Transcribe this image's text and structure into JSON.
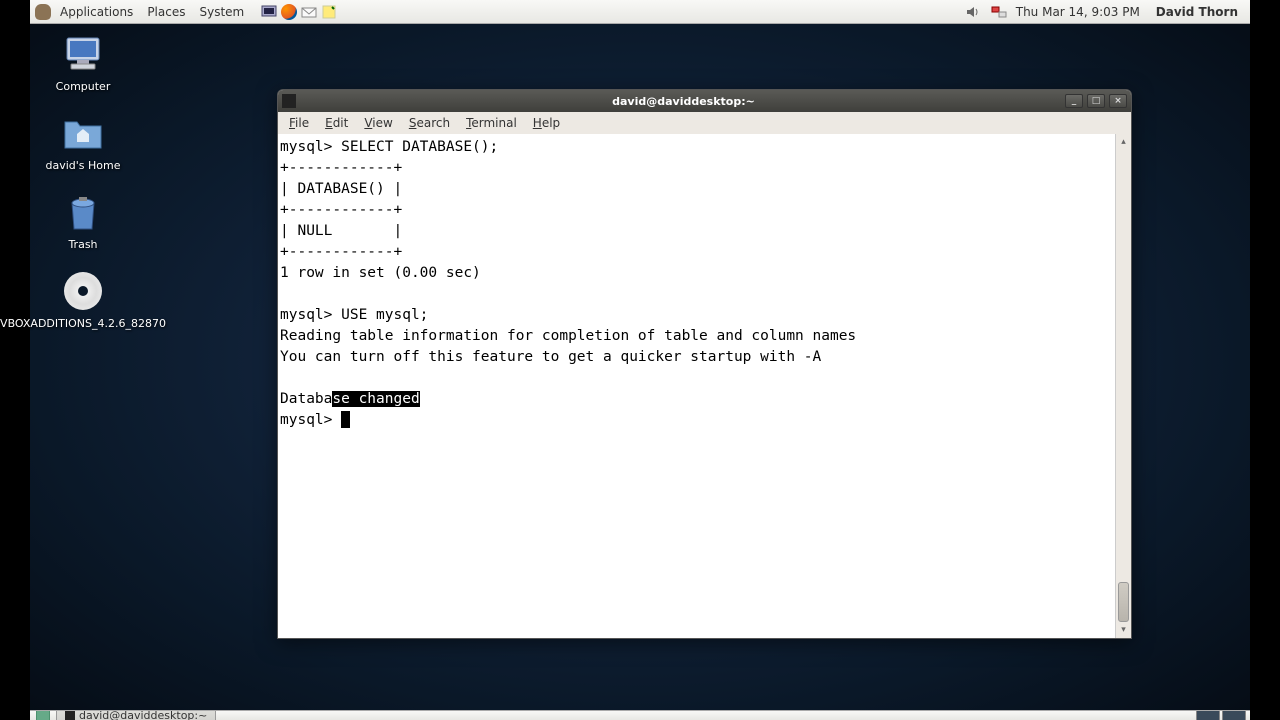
{
  "panel": {
    "apps": "Applications",
    "places": "Places",
    "system": "System",
    "clock": "Thu Mar 14,  9:03 PM",
    "user": "David Thorn"
  },
  "desktop": {
    "computer": "Computer",
    "home": "david's Home",
    "trash": "Trash",
    "vbox": "VBOXADDITIONS_4.2.6_82870"
  },
  "window": {
    "title": "david@daviddesktop:~",
    "menu": {
      "file": "File",
      "edit": "Edit",
      "view": "View",
      "search": "Search",
      "terminal": "Terminal",
      "help": "Help"
    }
  },
  "term": {
    "l1": "mysql> SELECT DATABASE();",
    "l2": "+------------+",
    "l3": "| DATABASE() |",
    "l4": "+------------+",
    "l5": "| NULL       |",
    "l6": "+------------+",
    "l7": "1 row in set (0.00 sec)",
    "l8": "",
    "l9": "mysql> USE mysql;",
    "l10": "Reading table information for completion of table and column names",
    "l11": "You can turn off this feature to get a quicker startup with -A",
    "l12": "",
    "l13a": "Databa",
    "l13b": "se changed",
    "l14": "mysql> "
  },
  "taskbar": {
    "task1": "david@daviddesktop:~"
  }
}
